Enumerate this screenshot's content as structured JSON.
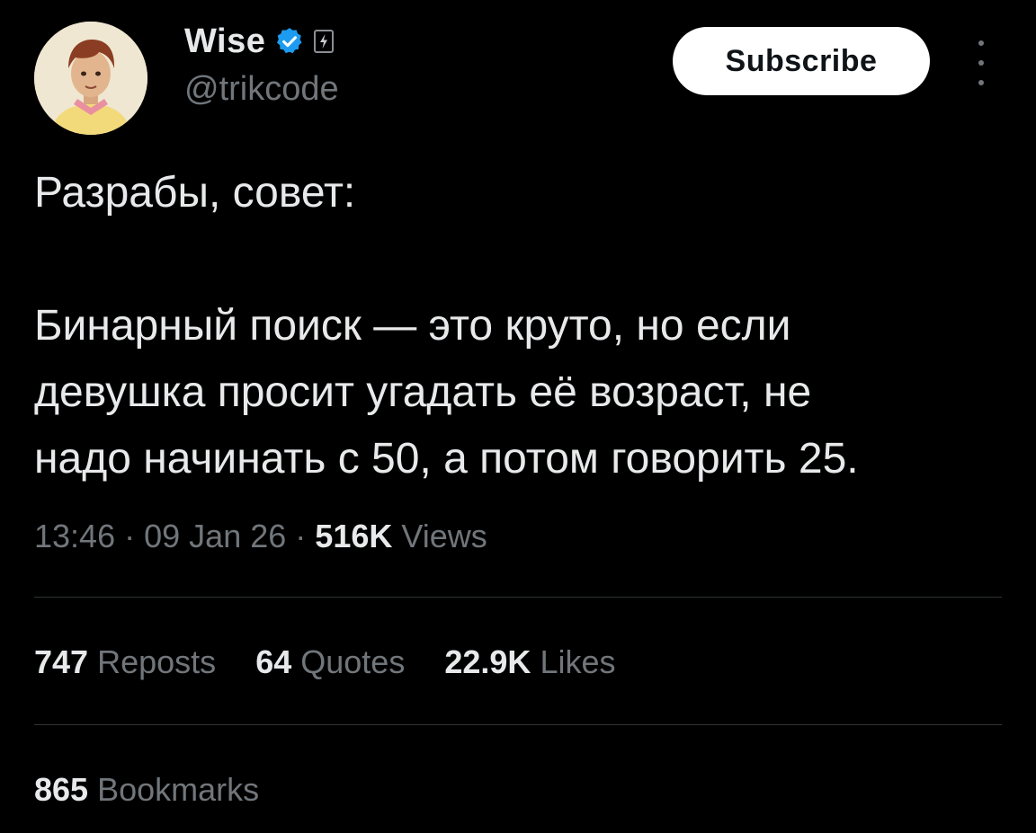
{
  "author": {
    "display_name": "Wise",
    "handle": "@trikcode",
    "verified_icon": "verified-badge-icon",
    "affiliate_icon": "lightning-badge-icon"
  },
  "actions": {
    "subscribe_label": "Subscribe",
    "more_icon": "more-vertical-icon"
  },
  "tweet": {
    "line1": "Разрабы, совет:",
    "line2": "Бинарный поиск — это круто, но если",
    "line3": "девушка просит угадать её возраст, не",
    "line4": "надо начинать с 50, а потом говорить 25."
  },
  "meta": {
    "time": "13:46",
    "date": "09 Jan 26",
    "views_count": "516K",
    "views_label": "Views",
    "separator": "·"
  },
  "stats": {
    "reposts_count": "747",
    "reposts_label": "Reposts",
    "quotes_count": "64",
    "quotes_label": "Quotes",
    "likes_count": "22.9K",
    "likes_label": "Likes",
    "bookmarks_count": "865",
    "bookmarks_label": "Bookmarks"
  },
  "colors": {
    "background": "#000000",
    "text": "#e7e9ea",
    "muted": "#71767b",
    "verified": "#1d9bf0",
    "divider": "#2f3336"
  }
}
